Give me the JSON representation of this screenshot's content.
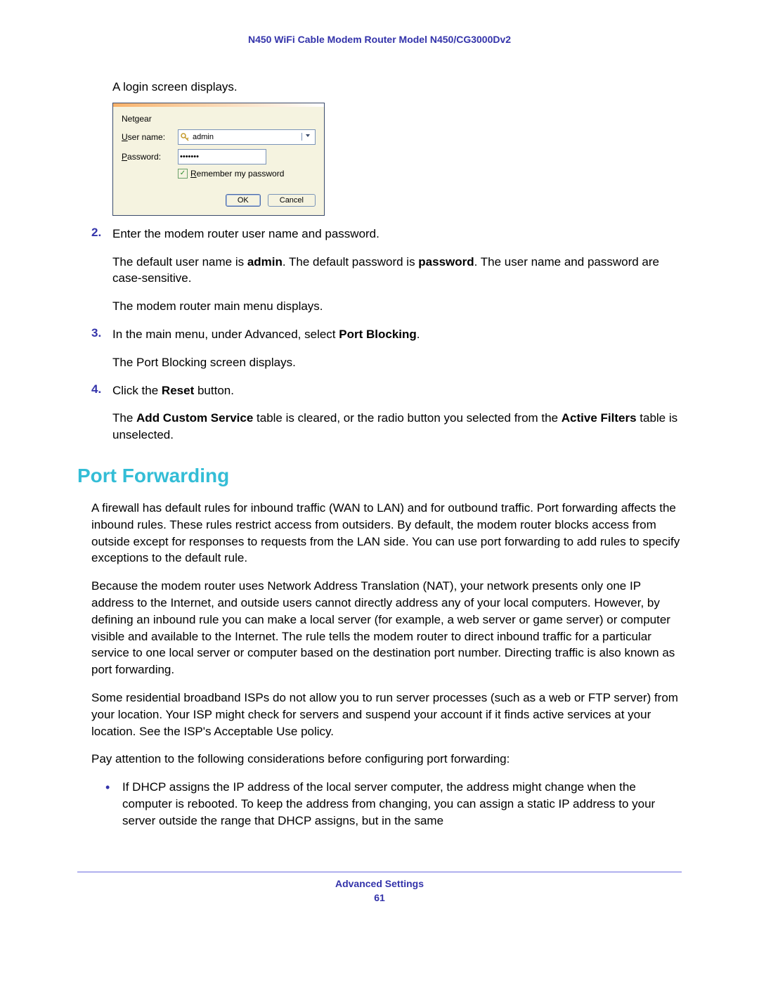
{
  "header": {
    "title": "N450 WiFi Cable Modem Router Model N450/CG3000Dv2"
  },
  "intro": "A login screen displays.",
  "login_dialog": {
    "brand": "Netgear",
    "username_label_prefix": "U",
    "username_label_rest": "ser name:",
    "username_value": "admin",
    "password_label_prefix": "P",
    "password_label_rest": "assword:",
    "password_value": "•••••••",
    "remember_prefix": "R",
    "remember_rest": "emember my password",
    "ok": "OK",
    "cancel": "Cancel"
  },
  "steps": [
    {
      "num": "2.",
      "paragraphs": [
        [
          {
            "t": "Enter the modem router user name and password."
          }
        ],
        [
          {
            "t": "The default user name is "
          },
          {
            "t": "admin",
            "b": true
          },
          {
            "t": ". The default password is "
          },
          {
            "t": "password",
            "b": true
          },
          {
            "t": ". The user name and password are case-sensitive."
          }
        ],
        [
          {
            "t": "The modem router main menu displays."
          }
        ]
      ]
    },
    {
      "num": "3.",
      "paragraphs": [
        [
          {
            "t": "In the main menu, under Advanced, select "
          },
          {
            "t": "Port Blocking",
            "b": true
          },
          {
            "t": "."
          }
        ],
        [
          {
            "t": "The Port Blocking screen displays."
          }
        ]
      ]
    },
    {
      "num": "4.",
      "paragraphs": [
        [
          {
            "t": "Click the "
          },
          {
            "t": "Reset",
            "b": true
          },
          {
            "t": " button."
          }
        ],
        [
          {
            "t": "The "
          },
          {
            "t": "Add Custom Service",
            "b": true
          },
          {
            "t": " table is cleared, or the radio button you selected from the "
          },
          {
            "t": "Active Filters",
            "b": true
          },
          {
            "t": " table is unselected."
          }
        ]
      ]
    }
  ],
  "section_heading": "Port Forwarding",
  "body_paragraphs": [
    "A firewall has default rules for inbound traffic (WAN to LAN) and for outbound traffic. Port forwarding affects the inbound rules. These rules restrict access from outsiders. By default, the modem router blocks access from outside except for responses to requests from the LAN side. You can use port forwarding to add rules to specify exceptions to the default rule.",
    "Because the modem router uses Network Address Translation (NAT), your network presents only one IP address to the Internet, and outside users cannot directly address any of your local computers. However, by defining an inbound rule you can make a local server (for example, a web server or game server) or computer visible and available to the Internet. The rule tells the modem router to direct inbound traffic for a particular service to one local server or computer based on the destination port number. Directing traffic is also known as port forwarding.",
    "Some residential broadband ISPs do not allow you to run server processes (such as a web or FTP server) from your location. Your ISP might check for servers and suspend your account if it finds active services at your location. See the ISP's Acceptable Use policy.",
    "Pay attention to the following considerations before configuring port forwarding:"
  ],
  "bullets": [
    "If DHCP assigns the IP address of the local server computer, the address might change when the computer is rebooted. To keep the address from changing, you can assign a static IP address to your server outside the range that DHCP assigns, but in the same"
  ],
  "footer": {
    "section": "Advanced Settings",
    "page": "61"
  }
}
